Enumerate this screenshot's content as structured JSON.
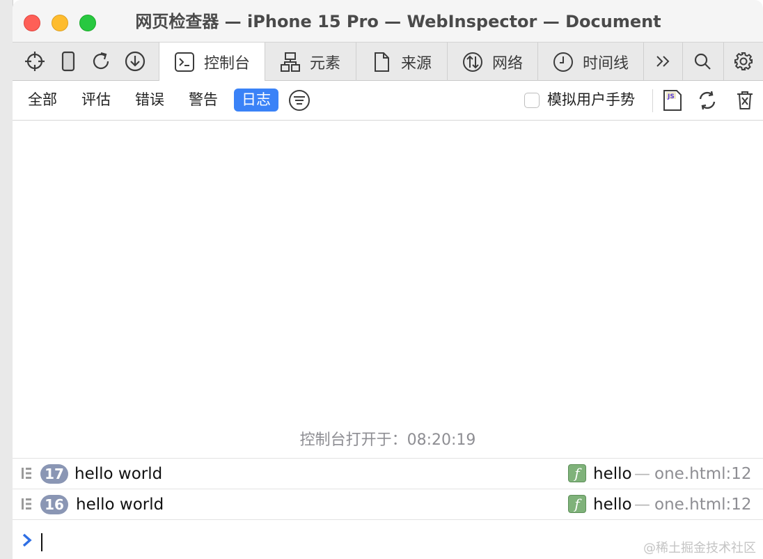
{
  "window": {
    "title": "网页检查器 — iPhone 15 Pro — WebInspector — Document"
  },
  "toolbar": {
    "tools": [
      {
        "icon": "crosshair-icon"
      },
      {
        "icon": "device-icon"
      },
      {
        "icon": "reload-icon"
      },
      {
        "icon": "download-icon"
      }
    ],
    "more_icon": "double-chevron-right-icon",
    "search_icon": "search-icon",
    "settings_icon": "gear-icon"
  },
  "tabs": [
    {
      "label": "控制台",
      "icon": "console-icon",
      "active": true
    },
    {
      "label": "元素",
      "icon": "elements-icon",
      "active": false
    },
    {
      "label": "来源",
      "icon": "document-icon",
      "active": false
    },
    {
      "label": "网络",
      "icon": "network-icon",
      "active": false
    },
    {
      "label": "时间线",
      "icon": "clock-icon",
      "active": false
    }
  ],
  "filters": {
    "items": [
      {
        "label": "全部",
        "active": false
      },
      {
        "label": "评估",
        "active": false
      },
      {
        "label": "错误",
        "active": false
      },
      {
        "label": "警告",
        "active": false
      },
      {
        "label": "日志",
        "active": true
      }
    ],
    "filter_icon": "filter-lines-icon",
    "simulate_gesture_label": "模拟用户手势",
    "simulate_gesture_checked": false,
    "js_icon_text": "JS"
  },
  "console": {
    "opened_message": "控制台打开于：08:20:19",
    "entries": [
      {
        "count": "17",
        "message": "hello world",
        "fn_glyph": "f",
        "function": "hello",
        "dash": "—",
        "source": "one.html:12"
      },
      {
        "count": "16",
        "message": "hello world",
        "fn_glyph": "f",
        "function": "hello",
        "dash": "—",
        "source": "one.html:12"
      }
    ],
    "prompt_value": ""
  },
  "watermark": "@稀土掘金技术社区",
  "colors": {
    "accent": "#3a82f7",
    "badge": "#8a96b4",
    "function_icon": "#7fb27a",
    "traffic_close": "#fe5f57",
    "traffic_min": "#febc2e",
    "traffic_max": "#28c840"
  }
}
